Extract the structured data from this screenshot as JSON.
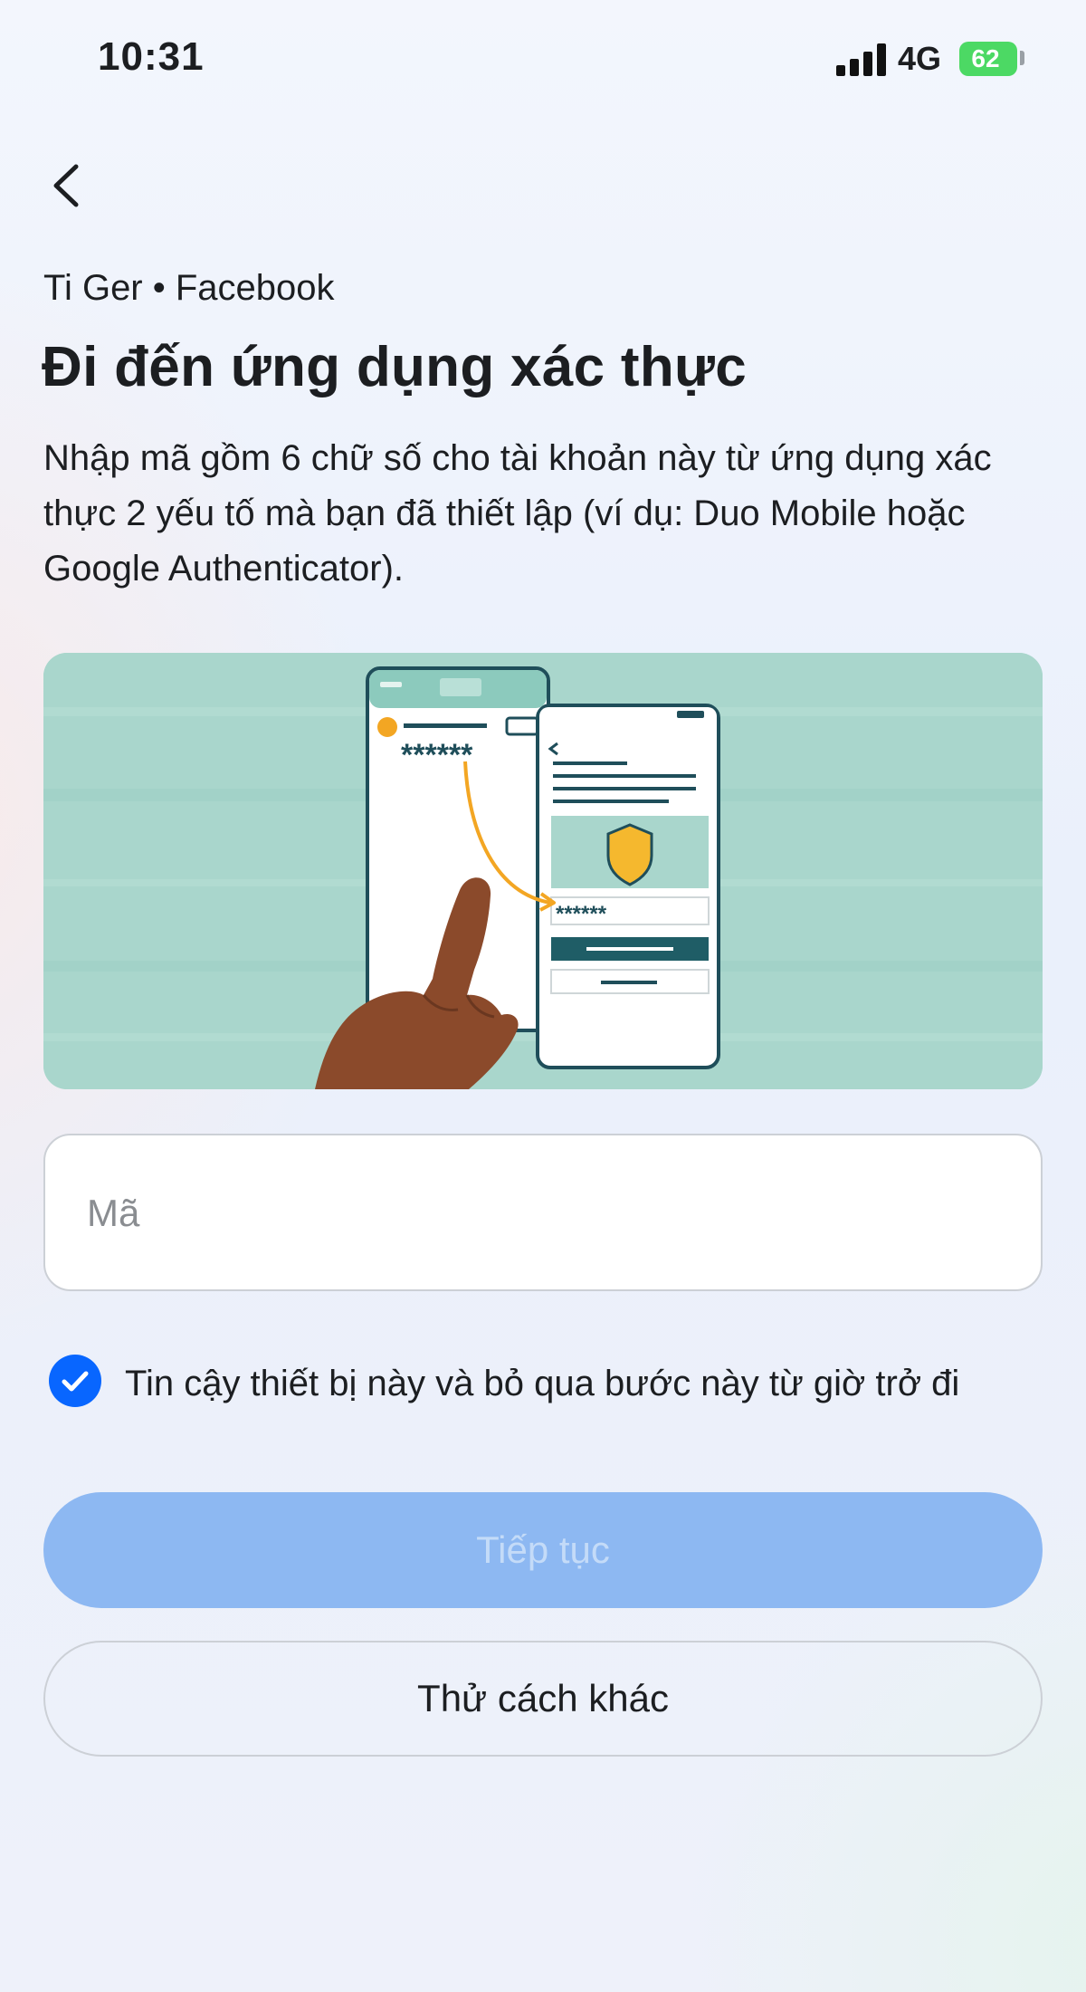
{
  "status_bar": {
    "time": "10:31",
    "network": "4G",
    "battery": "62",
    "battery_color": "#4cd964"
  },
  "header": {
    "back_icon": "chevron-left-icon",
    "account": "Ti Ger • Facebook",
    "title": "Đi đến ứng dụng xác thực",
    "description": "Nhập mã gồm 6 chữ số cho tài khoản này từ ứng dụng xác thực 2 yếu tố mà bạn đã thiết lập (ví dụ: Duo Mobile hoặc Google Authenticator)."
  },
  "illustration": {
    "background": "#a9d6cc",
    "masked_code_left": "******",
    "masked_code_right": "******"
  },
  "code_input": {
    "value": "",
    "placeholder": "Mã"
  },
  "trust_device": {
    "checked": true,
    "label": "Tin cậy thiết bị này và bỏ qua bước này từ giờ trở đi"
  },
  "actions": {
    "continue_label": "Tiếp tục",
    "continue_enabled": false,
    "other_label": "Thử cách khác"
  },
  "colors": {
    "accent": "#0866ff",
    "button_disabled": "#8db8f2",
    "shield": "#f5b82e"
  }
}
